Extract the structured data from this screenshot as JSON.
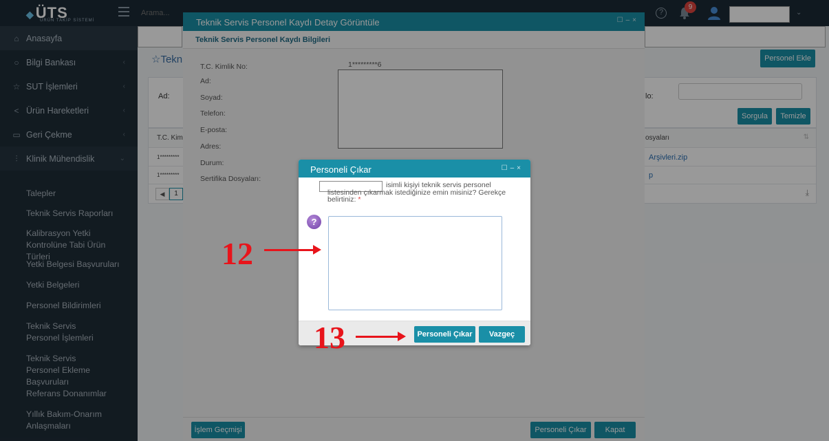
{
  "app": {
    "logo_text": "ÜTS",
    "logo_sub": "ÜRÜN TAKİP SİSTEMİ",
    "search_placeholder": "Arama...",
    "notification_count": "9"
  },
  "sidebar": {
    "items": [
      {
        "label": "Anasayfa",
        "icon": "home-icon"
      },
      {
        "label": "Bilgi Bankası",
        "icon": "lightbulb-icon"
      },
      {
        "label": "SUT İşlemleri",
        "icon": "star-icon"
      },
      {
        "label": "Ürün Hareketleri",
        "icon": "share-icon"
      },
      {
        "label": "Geri Çekme",
        "icon": "monitor-icon"
      },
      {
        "label": "Klinik Mühendislik",
        "icon": "sliders-icon"
      }
    ],
    "sub_items": [
      "Talepler",
      "Teknik Servis Raporları",
      "Kalibrasyon Yetki Kontrolüne Tabi Ürün Türleri",
      "Yetki Belgesi Başvuruları",
      "Yetki Belgeleri",
      "Personel Bildirimleri",
      "Teknik Servis Personel İşlemleri",
      "Teknik Servis Personel Ekleme Başvuruları",
      "Referans Donanımlar",
      "Yıllık Bakım-Onarım Anlaşmaları"
    ]
  },
  "main": {
    "page_title": "☆Teknik",
    "add_button": "Personel Ekle",
    "filter_ad_label": "Ad:",
    "filter_no_label": "lo:",
    "query_button": "Sorgula",
    "clear_button": "Temizle",
    "col_tc": "T.C. Kiml",
    "col_files": "osyaları",
    "rows": [
      {
        "tc": "1*********",
        "file": "Arşivleri.zip"
      },
      {
        "tc": "1*********",
        "file": "p"
      }
    ],
    "page_number": "1"
  },
  "detail_dialog": {
    "title": "Teknik Servis Personel Kaydı Detay Görüntüle",
    "section_title": "Teknik Servis Personel Kaydı Bilgileri",
    "fields": [
      {
        "label": "T.C. Kimlik No:",
        "value": "1*********6"
      },
      {
        "label": "Ad:",
        "value": ""
      },
      {
        "label": "Soyad:",
        "value": ""
      },
      {
        "label": "Telefon:",
        "value": ""
      },
      {
        "label": "E-posta:",
        "value": ""
      },
      {
        "label": "Adres:",
        "value": ""
      },
      {
        "label": "Durum:",
        "value": ""
      },
      {
        "label": "Sertifika Dosyaları:",
        "value": ""
      }
    ],
    "history_button": "İşlem Geçmişi",
    "remove_button": "Personeli Çıkar",
    "close_button": "Kapat"
  },
  "confirm_dialog": {
    "title": "Personeli Çıkar",
    "message_line1": "isimli kişiyi teknik servis personel",
    "message_line2": "listesinden çıkarmak istediğinize emin misiniz? Gerekçe",
    "message_line3": "belirtiniz:",
    "required_mark": "*",
    "confirm_button": "Personeli Çıkar",
    "cancel_button": "Vazgeç"
  },
  "annotations": {
    "step_12": "12",
    "step_13": "13"
  },
  "colors": {
    "accent": "#1a8fa7",
    "sidebar_bg": "#1f2d38",
    "annotation_red": "#e8141b"
  }
}
